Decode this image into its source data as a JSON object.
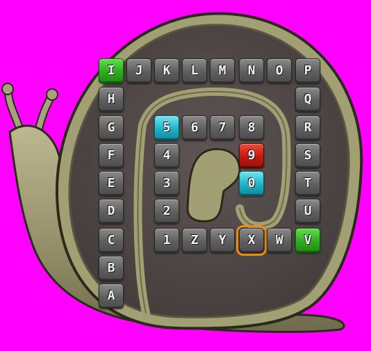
{
  "board": {
    "tiles": [
      {
        "id": "tile-i",
        "char": "I",
        "color": "green"
      },
      {
        "id": "tile-j",
        "char": "J"
      },
      {
        "id": "tile-k",
        "char": "K"
      },
      {
        "id": "tile-l",
        "char": "L"
      },
      {
        "id": "tile-m",
        "char": "M"
      },
      {
        "id": "tile-n",
        "char": "N"
      },
      {
        "id": "tile-o",
        "char": "O"
      },
      {
        "id": "tile-p",
        "char": "P"
      },
      {
        "id": "tile-h",
        "char": "H"
      },
      {
        "id": "tile-q",
        "char": "Q"
      },
      {
        "id": "tile-g",
        "char": "G"
      },
      {
        "id": "tile-5",
        "char": "5",
        "color": "cyan"
      },
      {
        "id": "tile-6",
        "char": "6"
      },
      {
        "id": "tile-7",
        "char": "7"
      },
      {
        "id": "tile-8",
        "char": "8"
      },
      {
        "id": "tile-r",
        "char": "R"
      },
      {
        "id": "tile-f",
        "char": "F"
      },
      {
        "id": "tile-4",
        "char": "4"
      },
      {
        "id": "tile-9",
        "char": "9",
        "color": "red"
      },
      {
        "id": "tile-s",
        "char": "S"
      },
      {
        "id": "tile-e",
        "char": "E"
      },
      {
        "id": "tile-3",
        "char": "3"
      },
      {
        "id": "tile-0",
        "char": "0",
        "color": "cyan"
      },
      {
        "id": "tile-t",
        "char": "T"
      },
      {
        "id": "tile-d",
        "char": "D"
      },
      {
        "id": "tile-2",
        "char": "2"
      },
      {
        "id": "tile-u",
        "char": "U"
      },
      {
        "id": "tile-c",
        "char": "C"
      },
      {
        "id": "tile-1",
        "char": "1"
      },
      {
        "id": "tile-z",
        "char": "Z"
      },
      {
        "id": "tile-y",
        "char": "Y"
      },
      {
        "id": "tile-x",
        "char": "X",
        "selected": true
      },
      {
        "id": "tile-w",
        "char": "W"
      },
      {
        "id": "tile-v",
        "char": "V",
        "color": "green"
      },
      {
        "id": "tile-b",
        "char": "B"
      },
      {
        "id": "tile-a",
        "char": "A"
      }
    ]
  },
  "colors": {
    "background": "#ff00ff",
    "shell_inner": "#554b4a",
    "shell_rim": "#a39f74",
    "snail_body": "#a8a27c",
    "tile_gray": "#6b6b6b",
    "tile_green": "#33b022",
    "tile_cyan": "#1fb2c6",
    "tile_red": "#c01a10",
    "selection": "#f08a10"
  }
}
